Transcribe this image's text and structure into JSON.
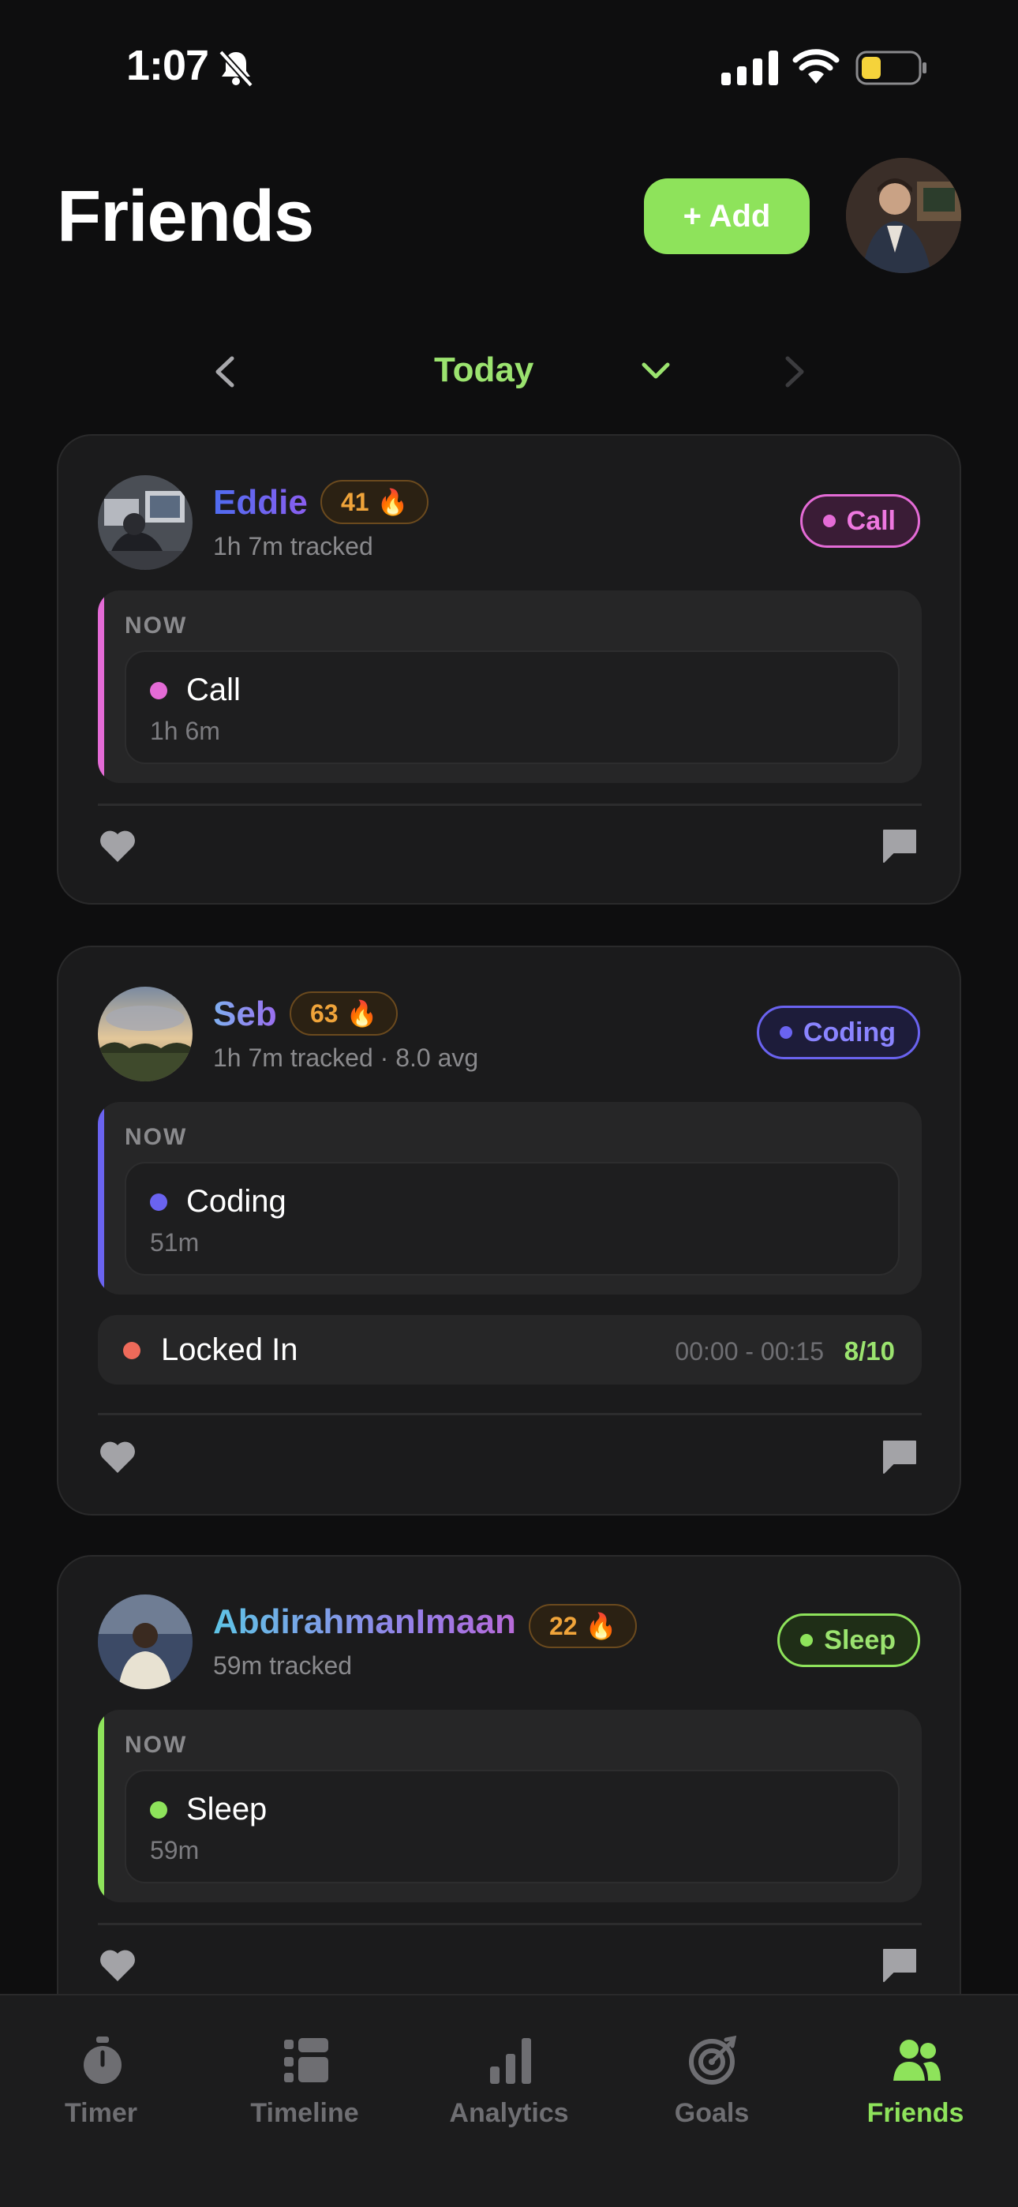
{
  "status_bar": {
    "time": "1:07"
  },
  "header": {
    "title": "Friends",
    "add_label": "+ Add"
  },
  "date_nav": {
    "label": "Today"
  },
  "colors": {
    "accent": "#8ee35b",
    "call": "#e46bd6",
    "coding": "#6a63f0",
    "sleep": "#8ee35b",
    "locked_in": "#ee6a5a",
    "streak": "#f0a43a"
  },
  "friends": [
    {
      "name": "Eddie",
      "streak": "41",
      "streak_icon": "🔥",
      "tracked": "1h 7m tracked",
      "status": "Call",
      "now_label": "NOW",
      "activity": {
        "name": "Call",
        "duration": "1h 6m"
      }
    },
    {
      "name": "Seb",
      "streak": "63",
      "streak_icon": "🔥",
      "tracked": "1h 7m tracked · 8.0 avg",
      "status": "Coding",
      "now_label": "NOW",
      "activity": {
        "name": "Coding",
        "duration": "51m"
      },
      "session": {
        "name": "Locked In",
        "time": "00:00 - 00:15",
        "score": "8/10"
      }
    },
    {
      "name": "AbdirahmanImaan",
      "streak": "22",
      "streak_icon": "🔥",
      "tracked": "59m tracked",
      "status": "Sleep",
      "now_label": "NOW",
      "activity": {
        "name": "Sleep",
        "duration": "59m"
      }
    }
  ],
  "tabs": [
    {
      "label": "Timer",
      "icon": "stopwatch-icon"
    },
    {
      "label": "Timeline",
      "icon": "timeline-icon"
    },
    {
      "label": "Analytics",
      "icon": "bar-chart-icon"
    },
    {
      "label": "Goals",
      "icon": "target-icon"
    },
    {
      "label": "Friends",
      "icon": "people-icon",
      "active": true
    }
  ]
}
